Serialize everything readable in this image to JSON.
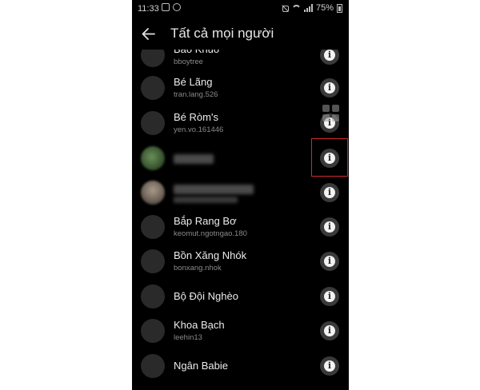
{
  "status_bar": {
    "time": "11:33",
    "battery": "75%"
  },
  "header": {
    "title": "Tất cả mọi người"
  },
  "contacts": [
    {
      "name": "Bảo Khuơ",
      "username": "bboytree"
    },
    {
      "name": "Bé Lãng",
      "username": "tran.lang.526"
    },
    {
      "name": "Bé Ròm's",
      "username": "yen.vo.161446"
    },
    {
      "name": "",
      "username": ""
    },
    {
      "name": "",
      "username": ""
    },
    {
      "name": "Bắp Rang Bơ",
      "username": "keomut.ngotngao.180"
    },
    {
      "name": "Bồn Xăng Nhók",
      "username": "bonxang.nhok"
    },
    {
      "name": "Bộ Đội Nghèo",
      "username": ""
    },
    {
      "name": "Khoa Bạch",
      "username": "leehin13"
    },
    {
      "name": "Ngân Babie",
      "username": ""
    }
  ],
  "icons": {
    "back": "arrow-left-icon",
    "info": "info-icon",
    "avatar": "avatar-placeholder",
    "overlay": "grid-icon"
  },
  "colors": {
    "background": "#000000",
    "text_primary": "#ececec",
    "text_secondary": "#8a8a8a",
    "avatar": "#2a2a2a",
    "info_button": "#3a3a3a",
    "highlight": "#d02a2a"
  }
}
